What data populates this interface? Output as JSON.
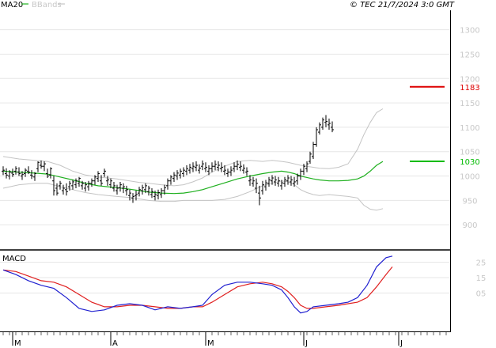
{
  "header": {
    "legend_ma": "MA20",
    "legend_bb": "BBands",
    "copyright": "© TEC 21/7/2024 3:0 GMT"
  },
  "colors": {
    "ma": "#1fb01f",
    "bbands": "#c4c4c4",
    "price": "#000000",
    "grid": "#e6e6e6",
    "macd": "#2020d0",
    "signal": "#e02020",
    "resistance": "#dd0000",
    "support": "#00bb00",
    "axis_text": "#c8c8c8"
  },
  "chart_data": [
    {
      "type": "line",
      "name": "price-panel",
      "ylim": [
        850,
        1340
      ],
      "y_ticks": [
        900,
        950,
        1000,
        1050,
        1100,
        1150,
        1200,
        1250,
        1300
      ],
      "x_months": [
        {
          "label": "M",
          "x": 2
        },
        {
          "label": "A",
          "x": 33
        },
        {
          "label": "M",
          "x": 63
        },
        {
          "label": "J",
          "x": 94
        },
        {
          "label": "J",
          "x": 124
        }
      ],
      "x_max": 140,
      "levels": [
        {
          "value": 1183,
          "label": "1183",
          "color_key": "resistance"
        },
        {
          "value": 1030,
          "label": "1030",
          "color_key": "support"
        }
      ],
      "ohlc": [
        [
          1010,
          1020,
          1002,
          1012
        ],
        [
          1005,
          1016,
          995,
          1002
        ],
        [
          1000,
          1012,
          993,
          1008
        ],
        [
          1006,
          1015,
          998,
          1003
        ],
        [
          1010,
          1020,
          1003,
          1015
        ],
        [
          1008,
          1018,
          1000,
          1005
        ],
        [
          1000,
          1010,
          992,
          1003
        ],
        [
          1005,
          1016,
          998,
          1012
        ],
        [
          1010,
          1020,
          1004,
          1008
        ],
        [
          1002,
          1012,
          994,
          1000
        ],
        [
          998,
          1008,
          990,
          1005
        ],
        [
          1015,
          1030,
          1008,
          1028
        ],
        [
          1022,
          1032,
          1015,
          1020
        ],
        [
          1020,
          1030,
          1010,
          1025
        ],
        [
          1005,
          1015,
          996,
          1000
        ],
        [
          1002,
          1018,
          995,
          1015
        ],
        [
          990,
          1000,
          960,
          970
        ],
        [
          975,
          985,
          960,
          965
        ],
        [
          980,
          990,
          972,
          985
        ],
        [
          970,
          982,
          962,
          975
        ],
        [
          972,
          985,
          960,
          968
        ],
        [
          978,
          990,
          970,
          985
        ],
        [
          980,
          992,
          972,
          988
        ],
        [
          982,
          995,
          975,
          990
        ],
        [
          985,
          998,
          978,
          995
        ],
        [
          980,
          990,
          972,
          985
        ],
        [
          975,
          988,
          968,
          982
        ],
        [
          978,
          990,
          970,
          985
        ],
        [
          985,
          995,
          978,
          990
        ],
        [
          990,
          1002,
          982,
          998
        ],
        [
          995,
          1010,
          988,
          1005
        ],
        [
          990,
          1002,
          980,
          985
        ],
        [
          1005,
          1015,
          998,
          1010
        ],
        [
          990,
          1000,
          980,
          992
        ],
        [
          982,
          995,
          975,
          990
        ],
        [
          975,
          988,
          968,
          980
        ],
        [
          970,
          982,
          962,
          975
        ],
        [
          976,
          988,
          968,
          982
        ],
        [
          975,
          985,
          965,
          978
        ],
        [
          970,
          980,
          960,
          972
        ],
        [
          960,
          972,
          950,
          965
        ],
        [
          955,
          965,
          945,
          958
        ],
        [
          960,
          970,
          950,
          962
        ],
        [
          965,
          978,
          958,
          972
        ],
        [
          970,
          982,
          962,
          976
        ],
        [
          972,
          985,
          965,
          980
        ],
        [
          968,
          980,
          960,
          975
        ],
        [
          962,
          975,
          955,
          968
        ],
        [
          958,
          970,
          950,
          962
        ],
        [
          960,
          972,
          952,
          966
        ],
        [
          962,
          975,
          955,
          970
        ],
        [
          970,
          982,
          962,
          976
        ],
        [
          980,
          995,
          972,
          990
        ],
        [
          990,
          1002,
          982,
          998
        ],
        [
          995,
          1008,
          988,
          1002
        ],
        [
          1000,
          1012,
          992,
          1006
        ],
        [
          1002,
          1015,
          995,
          1010
        ],
        [
          1005,
          1018,
          998,
          1012
        ],
        [
          1010,
          1022,
          1002,
          1015
        ],
        [
          1012,
          1025,
          1005,
          1018
        ],
        [
          1015,
          1028,
          1008,
          1020
        ],
        [
          1018,
          1030,
          1010,
          1022
        ],
        [
          1012,
          1024,
          1005,
          1016
        ],
        [
          1020,
          1032,
          1012,
          1025
        ],
        [
          1015,
          1028,
          1008,
          1018
        ],
        [
          1010,
          1022,
          1002,
          1015
        ],
        [
          1015,
          1028,
          1008,
          1020
        ],
        [
          1020,
          1032,
          1012,
          1024
        ],
        [
          1018,
          1030,
          1010,
          1022
        ],
        [
          1015,
          1028,
          1008,
          1018
        ],
        [
          1010,
          1022,
          1002,
          1012
        ],
        [
          1005,
          1015,
          998,
          1008
        ],
        [
          1008,
          1020,
          1000,
          1012
        ],
        [
          1015,
          1028,
          1008,
          1020
        ],
        [
          1020,
          1032,
          1012,
          1024
        ],
        [
          1018,
          1030,
          1010,
          1020
        ],
        [
          1012,
          1024,
          1005,
          1016
        ],
        [
          1008,
          1018,
          1000,
          1010
        ],
        [
          990,
          1002,
          980,
          992
        ],
        [
          985,
          998,
          978,
          990
        ],
        [
          975,
          995,
          965,
          985
        ],
        [
          965,
          980,
          940,
          955
        ],
        [
          970,
          990,
          962,
          982
        ],
        [
          978,
          992,
          970,
          986
        ],
        [
          985,
          998,
          978,
          992
        ],
        [
          990,
          1002,
          982,
          996
        ],
        [
          988,
          1000,
          980,
          992
        ],
        [
          985,
          998,
          978,
          990
        ],
        [
          980,
          992,
          972,
          986
        ],
        [
          985,
          998,
          978,
          992
        ],
        [
          990,
          1002,
          982,
          996
        ],
        [
          988,
          1000,
          980,
          992
        ],
        [
          985,
          998,
          978,
          988
        ],
        [
          990,
          1005,
          982,
          1000
        ],
        [
          1000,
          1015,
          992,
          1010
        ],
        [
          1010,
          1025,
          1002,
          1020
        ],
        [
          1015,
          1030,
          1008,
          1025
        ],
        [
          1030,
          1050,
          1025,
          1045
        ],
        [
          1040,
          1070,
          1035,
          1065
        ],
        [
          1065,
          1100,
          1060,
          1095
        ],
        [
          1090,
          1110,
          1085,
          1105
        ],
        [
          1100,
          1120,
          1095,
          1115
        ],
        [
          1110,
          1125,
          1100,
          1112
        ],
        [
          1105,
          1118,
          1095,
          1108
        ],
        [
          1100,
          1112,
          1090,
          1095
        ]
      ],
      "ma20": [
        [
          0,
          1010
        ],
        [
          5,
          1008
        ],
        [
          10,
          1006
        ],
        [
          14,
          1004
        ],
        [
          18,
          998
        ],
        [
          22,
          992
        ],
        [
          26,
          985
        ],
        [
          30,
          980
        ],
        [
          33,
          978
        ],
        [
          36,
          976
        ],
        [
          40,
          973
        ],
        [
          43,
          970
        ],
        [
          46,
          967
        ],
        [
          50,
          965
        ],
        [
          54,
          964
        ],
        [
          57,
          965
        ],
        [
          60,
          968
        ],
        [
          63,
          972
        ],
        [
          66,
          978
        ],
        [
          70,
          986
        ],
        [
          74,
          994
        ],
        [
          78,
          1000
        ],
        [
          82,
          1005
        ],
        [
          85,
          1008
        ],
        [
          88,
          1010
        ],
        [
          90,
          1008
        ],
        [
          92,
          1005
        ],
        [
          94,
          1000
        ],
        [
          96,
          997
        ],
        [
          98,
          994
        ],
        [
          100,
          992
        ],
        [
          103,
          990
        ],
        [
          106,
          990
        ],
        [
          109,
          991
        ],
        [
          112,
          994
        ],
        [
          114,
          1000
        ],
        [
          116,
          1010
        ],
        [
          118,
          1022
        ],
        [
          120,
          1030
        ]
      ],
      "bb_upper": [
        [
          0,
          1040
        ],
        [
          5,
          1035
        ],
        [
          10,
          1032
        ],
        [
          14,
          1030
        ],
        [
          18,
          1022
        ],
        [
          22,
          1010
        ],
        [
          26,
          1002
        ],
        [
          30,
          998
        ],
        [
          33,
          996
        ],
        [
          36,
          994
        ],
        [
          40,
          990
        ],
        [
          43,
          987
        ],
        [
          46,
          985
        ],
        [
          50,
          982
        ],
        [
          54,
          980
        ],
        [
          57,
          982
        ],
        [
          60,
          988
        ],
        [
          63,
          996
        ],
        [
          66,
          1008
        ],
        [
          70,
          1020
        ],
        [
          74,
          1030
        ],
        [
          78,
          1032
        ],
        [
          82,
          1030
        ],
        [
          85,
          1032
        ],
        [
          88,
          1030
        ],
        [
          90,
          1028
        ],
        [
          92,
          1025
        ],
        [
          94,
          1022
        ],
        [
          96,
          1020
        ],
        [
          98,
          1018
        ],
        [
          100,
          1016
        ],
        [
          103,
          1015
        ],
        [
          106,
          1018
        ],
        [
          109,
          1025
        ],
        [
          112,
          1055
        ],
        [
          114,
          1085
        ],
        [
          116,
          1110
        ],
        [
          118,
          1130
        ],
        [
          120,
          1138
        ]
      ],
      "bb_lower": [
        [
          0,
          975
        ],
        [
          5,
          982
        ],
        [
          10,
          985
        ],
        [
          14,
          985
        ],
        [
          18,
          978
        ],
        [
          22,
          972
        ],
        [
          26,
          966
        ],
        [
          30,
          962
        ],
        [
          33,
          960
        ],
        [
          36,
          958
        ],
        [
          40,
          956
        ],
        [
          43,
          953
        ],
        [
          46,
          950
        ],
        [
          50,
          948
        ],
        [
          54,
          948
        ],
        [
          57,
          950
        ],
        [
          60,
          950
        ],
        [
          63,
          950
        ],
        [
          66,
          950
        ],
        [
          70,
          952
        ],
        [
          74,
          958
        ],
        [
          78,
          968
        ],
        [
          82,
          980
        ],
        [
          85,
          985
        ],
        [
          88,
          990
        ],
        [
          90,
          988
        ],
        [
          92,
          982
        ],
        [
          94,
          972
        ],
        [
          96,
          966
        ],
        [
          98,
          962
        ],
        [
          100,
          960
        ],
        [
          103,
          962
        ],
        [
          106,
          960
        ],
        [
          109,
          958
        ],
        [
          112,
          955
        ],
        [
          114,
          940
        ],
        [
          116,
          932
        ],
        [
          118,
          930
        ],
        [
          120,
          933
        ]
      ]
    },
    {
      "type": "line",
      "name": "macd-panel",
      "title": "MACD",
      "ylim": [
        -20,
        32
      ],
      "y_ticks": [
        {
          "value": 5,
          "label": "05"
        },
        {
          "value": 15,
          "label": "15"
        },
        {
          "value": 25,
          "label": "25"
        }
      ],
      "macd": [
        [
          0,
          20
        ],
        [
          4,
          17
        ],
        [
          8,
          13
        ],
        [
          12,
          10
        ],
        [
          16,
          8
        ],
        [
          20,
          2
        ],
        [
          24,
          -5
        ],
        [
          28,
          -7
        ],
        [
          32,
          -6
        ],
        [
          36,
          -3
        ],
        [
          40,
          -2
        ],
        [
          44,
          -3
        ],
        [
          48,
          -6
        ],
        [
          52,
          -4
        ],
        [
          56,
          -5
        ],
        [
          60,
          -4
        ],
        [
          63,
          -3
        ],
        [
          66,
          4
        ],
        [
          70,
          10
        ],
        [
          74,
          12
        ],
        [
          78,
          12
        ],
        [
          82,
          11
        ],
        [
          85,
          10
        ],
        [
          88,
          7
        ],
        [
          90,
          2
        ],
        [
          92,
          -4
        ],
        [
          94,
          -8
        ],
        [
          96,
          -7
        ],
        [
          98,
          -4
        ],
        [
          102,
          -3
        ],
        [
          106,
          -2
        ],
        [
          109,
          -1
        ],
        [
          112,
          2
        ],
        [
          115,
          10
        ],
        [
          118,
          22
        ],
        [
          121,
          28
        ],
        [
          123,
          29
        ]
      ],
      "signal": [
        [
          0,
          20
        ],
        [
          4,
          19
        ],
        [
          8,
          16
        ],
        [
          12,
          13
        ],
        [
          16,
          12
        ],
        [
          20,
          9
        ],
        [
          24,
          4
        ],
        [
          28,
          -1
        ],
        [
          32,
          -4
        ],
        [
          36,
          -4
        ],
        [
          40,
          -3
        ],
        [
          44,
          -3
        ],
        [
          48,
          -4
        ],
        [
          52,
          -5
        ],
        [
          56,
          -5
        ],
        [
          60,
          -4
        ],
        [
          63,
          -4
        ],
        [
          66,
          -1
        ],
        [
          70,
          4
        ],
        [
          74,
          9
        ],
        [
          78,
          11
        ],
        [
          82,
          12
        ],
        [
          85,
          11
        ],
        [
          88,
          9
        ],
        [
          90,
          6
        ],
        [
          92,
          2
        ],
        [
          94,
          -3
        ],
        [
          96,
          -5
        ],
        [
          98,
          -5
        ],
        [
          102,
          -4
        ],
        [
          106,
          -3
        ],
        [
          109,
          -2
        ],
        [
          112,
          -1
        ],
        [
          115,
          2
        ],
        [
          118,
          9
        ],
        [
          121,
          17
        ],
        [
          123,
          22
        ]
      ]
    }
  ]
}
